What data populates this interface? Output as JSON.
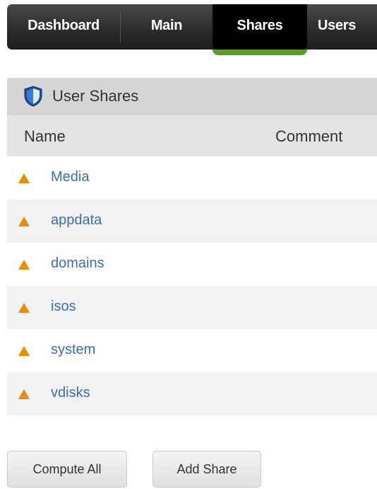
{
  "nav": {
    "tabs": [
      {
        "label": "Dashboard",
        "active": false
      },
      {
        "label": "Main",
        "active": false
      },
      {
        "label": "Shares",
        "active": true
      },
      {
        "label": "Users",
        "active": false
      }
    ],
    "active_color": "#5a9e2a"
  },
  "section": {
    "title": "User Shares",
    "icon": "shield-icon"
  },
  "table": {
    "columns": [
      "Name",
      "Comment"
    ],
    "status_icon": "warning-triangle-icon",
    "status_color": "#f08a00",
    "link_color": "#3c6db0",
    "rows": [
      {
        "name": "Media",
        "comment": ""
      },
      {
        "name": "appdata",
        "comment": ""
      },
      {
        "name": "domains",
        "comment": ""
      },
      {
        "name": "isos",
        "comment": ""
      },
      {
        "name": "system",
        "comment": ""
      },
      {
        "name": "vdisks",
        "comment": ""
      }
    ]
  },
  "buttons": {
    "compute_all": "Compute All",
    "add_share": "Add Share"
  }
}
